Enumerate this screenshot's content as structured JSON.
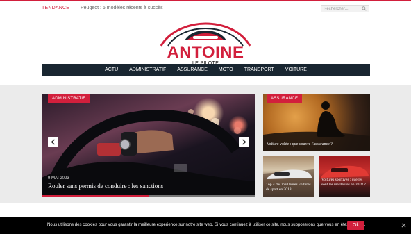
{
  "topbar": {
    "trend_label": "TENDANCE",
    "trend_text": "Peugeot : 6 modèles récents à succès",
    "search_placeholder": "Rechercher..."
  },
  "logo": {
    "name": "ANTOINE",
    "subtitle": "LE PILOTE"
  },
  "nav": {
    "items": [
      "ACTU",
      "ADMINISTRATIF",
      "ASSURANCE",
      "MOTO",
      "TRANSPORT",
      "VOITURE"
    ]
  },
  "slider": {
    "category": "ADMINISTRATIF",
    "date": "9 MAI 2023",
    "title": "Rouler sans permis de conduire : les sanctions",
    "progress": 0.5
  },
  "cards": [
    {
      "category": "ASSURANCE",
      "title": "Voiture volée : que couvre l'assurance ?"
    },
    {
      "title": "Top 4 des meilleures voitures de sport en 2018"
    },
    {
      "title": "Voitures sportives : quelles sont les meilleures en 2018 ?"
    }
  ],
  "cookie": {
    "text": "Nous utilisons des cookies pour vous garantir la meilleure expérience sur notre site web. Si vous continuez à utiliser ce site, nous supposerons que vous en êtes satisfait.",
    "ok_label": "Ok"
  },
  "colors": {
    "accent": "#d21f3c",
    "nav_bg": "#192631",
    "cookie_bg": "#000000"
  },
  "icons": {
    "search": "search-icon",
    "prev": "chevron-left-icon",
    "next": "chevron-right-icon",
    "close": "close-icon"
  }
}
